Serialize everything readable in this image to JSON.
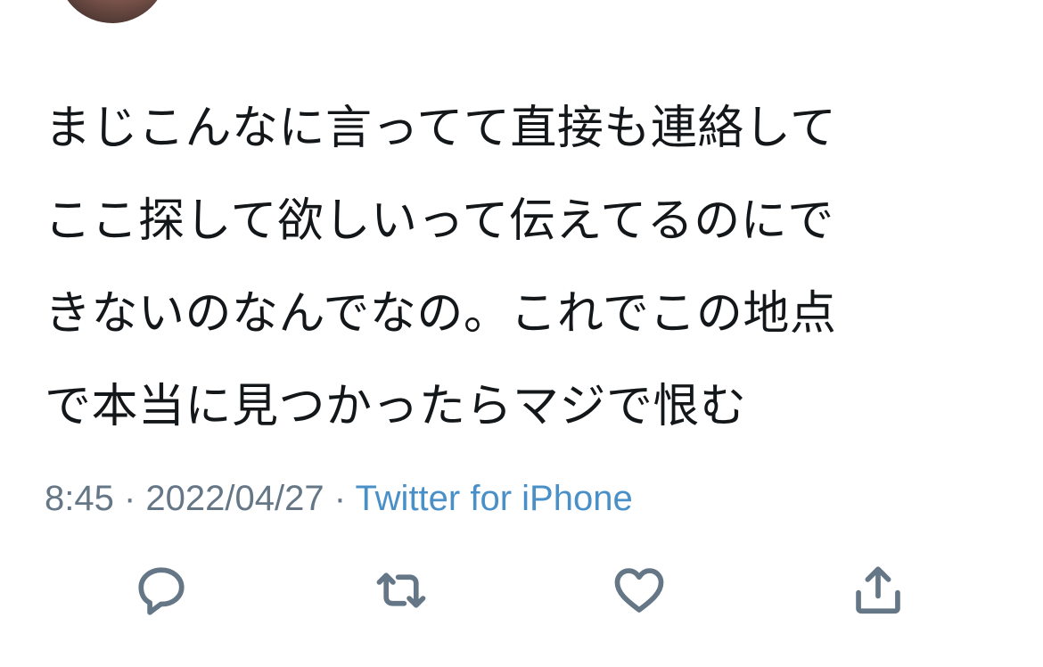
{
  "tweet": {
    "text_lines": [
      "まじこんなに言ってて直接も連絡して",
      "ここ探して欲しいって伝えてるのにで",
      "きないのなんでなの。これでこの地点",
      "で本当に見つかったらマジで恨む"
    ],
    "time": "8:45",
    "separator": " · ",
    "date": "2022/04/27",
    "source": "Twitter for iPhone"
  },
  "actions": [
    {
      "icon": "reply-icon"
    },
    {
      "icon": "retweet-icon"
    },
    {
      "icon": "like-heart-icon"
    },
    {
      "icon": "share-icon"
    }
  ],
  "colors": {
    "text": "#14171a",
    "meta": "#657786",
    "link": "#4a90c8"
  }
}
